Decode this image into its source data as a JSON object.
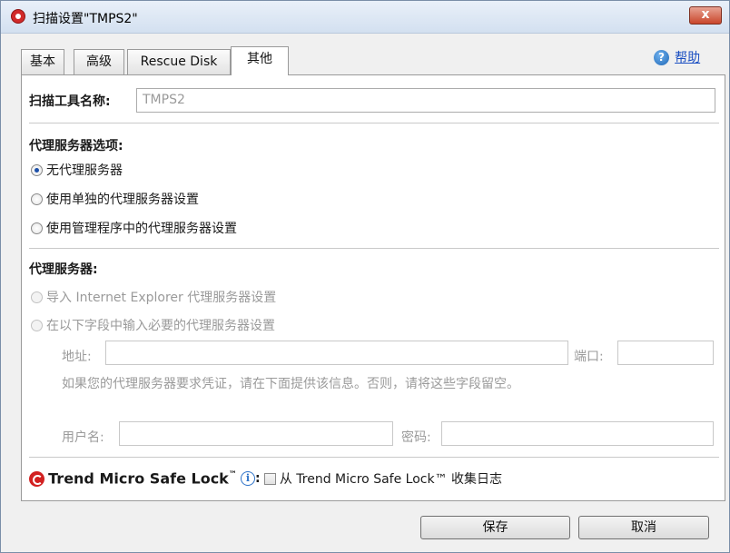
{
  "window": {
    "title": "扫描设置\"TMPS2\"",
    "close_label": "x"
  },
  "tabs": [
    {
      "label": "基本",
      "active": false
    },
    {
      "label": "高级",
      "active": false
    },
    {
      "label": "Rescue Disk",
      "active": false
    },
    {
      "label": "其他",
      "active": true
    }
  ],
  "help": {
    "label": "帮助",
    "icon": "help-icon",
    "icon_glyph": "?"
  },
  "scanner_name": {
    "label": "扫描工具名称:",
    "value": "TMPS2"
  },
  "proxy_options": {
    "heading": "代理服务器选项:",
    "items": [
      {
        "label": "无代理服务器",
        "checked": true
      },
      {
        "label": "使用单独的代理服务器设置",
        "checked": false
      },
      {
        "label": "使用管理程序中的代理服务器设置",
        "checked": false
      }
    ]
  },
  "proxy_server": {
    "heading": "代理服务器:",
    "import_ie_label": "导入 Internet Explorer 代理服务器设置",
    "manual_label": "在以下字段中输入必要的代理服务器设置",
    "address_label": "地址:",
    "address_value": "",
    "port_label": "端口:",
    "port_value": "",
    "credentials_note": "如果您的代理服务器要求凭证，请在下面提供该信息。否则，请将这些字段留空。",
    "username_label": "用户名:",
    "username_value": "",
    "password_label": "密码:",
    "password_value": ""
  },
  "safelock": {
    "brand": "Trend Micro Safe Lock",
    "trademark": "™",
    "info_glyph": "i",
    "colon": ":",
    "checkbox_label": "从 Trend Micro Safe Lock™ 收集日志",
    "checked": false
  },
  "buttons": {
    "save": "保存",
    "cancel": "取消"
  },
  "colors": {
    "accent": "#1c4fa8",
    "link": "#1b4fc2",
    "brand_red": "#d22020",
    "close": "#c9462b"
  }
}
